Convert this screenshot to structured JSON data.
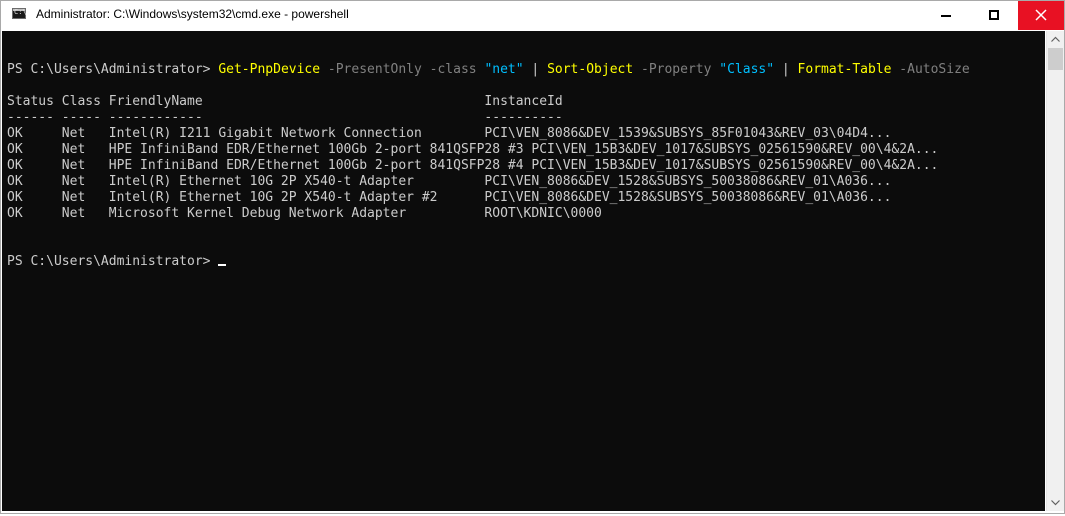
{
  "window": {
    "title": "Administrator: C:\\Windows\\system32\\cmd.exe - powershell",
    "icon": "console-icon"
  },
  "title_controls": {
    "minimize": "minimize-icon",
    "maximize": "maximize-icon",
    "close": "close-icon",
    "close_hover_color": "#e81123"
  },
  "console": {
    "background": "#0c0c0c",
    "foreground": "#cccccc",
    "command_line": {
      "prompt": "PS C:\\Users\\Administrator> ",
      "cmd1": "Get-PnpDevice",
      "param1": " -PresentOnly -class ",
      "str1": "\"net\"",
      "pipe1": " | ",
      "cmd2": "Sort-Object",
      "param2": " -Property ",
      "str2": "\"Class\"",
      "pipe2": " | ",
      "cmd3": "Format-Table",
      "param3": " -AutoSize"
    },
    "table_header": "Status Class FriendlyName                                    InstanceId",
    "table_separator": "------ ----- ------------                                    ----------",
    "rows": [
      "OK     Net   Intel(R) I211 Gigabit Network Connection        PCI\\VEN_8086&DEV_1539&SUBSYS_85F01043&REV_03\\04D4...",
      "OK     Net   HPE InfiniBand EDR/Ethernet 100Gb 2-port 841QSFP28 #3 PCI\\VEN_15B3&DEV_1017&SUBSYS_02561590&REV_00\\4&2A...",
      "OK     Net   HPE InfiniBand EDR/Ethernet 100Gb 2-port 841QSFP28 #4 PCI\\VEN_15B3&DEV_1017&SUBSYS_02561590&REV_00\\4&2A...",
      "OK     Net   Intel(R) Ethernet 10G 2P X540-t Adapter         PCI\\VEN_8086&DEV_1528&SUBSYS_50038086&REV_01\\A036...",
      "OK     Net   Intel(R) Ethernet 10G 2P X540-t Adapter #2      PCI\\VEN_8086&DEV_1528&SUBSYS_50038086&REV_01\\A036...",
      "OK     Net   Microsoft Kernel Debug Network Adapter          ROOT\\KDNIC\\0000"
    ],
    "final_prompt": "PS C:\\Users\\Administrator> "
  },
  "colors": {
    "cmdlet": "#ffff00",
    "parameter": "#808080",
    "string": "#00bfff"
  },
  "scrollbar": {
    "up_icon": "chevron-up-icon",
    "down_icon": "chevron-down-icon"
  }
}
